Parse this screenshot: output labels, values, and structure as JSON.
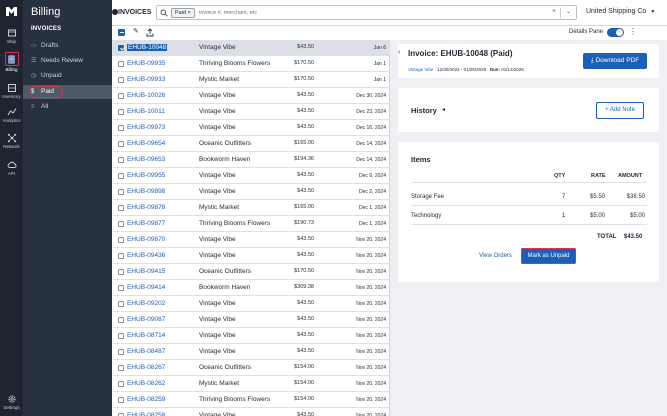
{
  "rail": {
    "items": [
      {
        "label": "Ship",
        "icon": "box-icon"
      },
      {
        "label": "Billing",
        "icon": "receipt-icon"
      },
      {
        "label": "Inventory",
        "icon": "inventory-icon"
      },
      {
        "label": "Analytics",
        "icon": "analytics-icon"
      },
      {
        "label": "Network",
        "icon": "network-icon"
      },
      {
        "label": "API",
        "icon": "cloud-icon"
      }
    ],
    "settings_label": "Settings"
  },
  "nav": {
    "title": "Billing",
    "section": "INVOICES",
    "items": [
      {
        "label": "Drafts",
        "icon": "drafts-icon"
      },
      {
        "label": "Needs Review",
        "icon": "review-icon"
      },
      {
        "label": "Unpaid",
        "icon": "unpaid-icon"
      },
      {
        "label": "Paid",
        "icon": "dollar-icon"
      },
      {
        "label": "All",
        "icon": "all-icon"
      }
    ]
  },
  "topbar": {
    "title": "INVOICES",
    "chip_label": "Paid",
    "chip_close": "×",
    "search_placeholder": "invoice #, merchant, etc",
    "clear": "×",
    "chevron": "⌄",
    "company": "United Shipping Co"
  },
  "toolbar": {
    "details_pane_label": "Details Pane",
    "details_pane_on": true,
    "more": "⋮"
  },
  "invoices": [
    {
      "id": "EHUB-10048",
      "merchant": "Vintage Vibe",
      "amount": "$43.50",
      "date": "Jan 6",
      "selected": true
    },
    {
      "id": "EHUB-09935",
      "merchant": "Thriving Blooms Flowers",
      "amount": "$170.50",
      "date": "Jan 1"
    },
    {
      "id": "EHUB-09933",
      "merchant": "Mystic Market",
      "amount": "$170.50",
      "date": "Jan 1"
    },
    {
      "id": "EHUB-10026",
      "merchant": "Vintage Vibe",
      "amount": "$43.50",
      "date": "Dec 30, 2024"
    },
    {
      "id": "EHUB-10011",
      "merchant": "Vintage Vibe",
      "amount": "$43.50",
      "date": "Dec 23, 2024"
    },
    {
      "id": "EHUB-09973",
      "merchant": "Vintage Vibe",
      "amount": "$43.50",
      "date": "Dec 16, 2024"
    },
    {
      "id": "EHUB-09654",
      "merchant": "Oceanic Outfitters",
      "amount": "$165.00",
      "date": "Dec 14, 2024"
    },
    {
      "id": "EHUB-09653",
      "merchant": "Bookworm Haven",
      "amount": "$194.36",
      "date": "Dec 14, 2024"
    },
    {
      "id": "EHUB-09955",
      "merchant": "Vintage Vibe",
      "amount": "$43.50",
      "date": "Dec 9, 2024"
    },
    {
      "id": "EHUB-09898",
      "merchant": "Vintage Vibe",
      "amount": "$43.50",
      "date": "Dec 2, 2024"
    },
    {
      "id": "EHUB-09878",
      "merchant": "Mystic Market",
      "amount": "$165.00",
      "date": "Dec 1, 2024"
    },
    {
      "id": "EHUB-09877",
      "merchant": "Thriving Blooms Flowers",
      "amount": "$190.73",
      "date": "Dec 1, 2024"
    },
    {
      "id": "EHUB-09670",
      "merchant": "Vintage Vibe",
      "amount": "$43.50",
      "date": "Nov 20, 2024"
    },
    {
      "id": "EHUB-09436",
      "merchant": "Vintage Vibe",
      "amount": "$43.50",
      "date": "Nov 20, 2024"
    },
    {
      "id": "EHUB-09415",
      "merchant": "Oceanic Outfitters",
      "amount": "$170.50",
      "date": "Nov 20, 2024"
    },
    {
      "id": "EHUB-09414",
      "merchant": "Bookworm Haven",
      "amount": "$309.38",
      "date": "Nov 20, 2024"
    },
    {
      "id": "EHUB-09202",
      "merchant": "Vintage Vibe",
      "amount": "$43.50",
      "date": "Nov 20, 2024"
    },
    {
      "id": "EHUB-09087",
      "merchant": "Vintage Vibe",
      "amount": "$43.50",
      "date": "Nov 20, 2024"
    },
    {
      "id": "EHUB-08714",
      "merchant": "Vintage Vibe",
      "amount": "$43.50",
      "date": "Nov 20, 2024"
    },
    {
      "id": "EHUB-08487",
      "merchant": "Vintage Vibe",
      "amount": "$43.50",
      "date": "Nov 20, 2024"
    },
    {
      "id": "EHUB-08267",
      "merchant": "Oceanic Outfitters",
      "amount": "$154.00",
      "date": "Nov 20, 2024"
    },
    {
      "id": "EHUB-08262",
      "merchant": "Mystic Market",
      "amount": "$154.00",
      "date": "Nov 20, 2024"
    },
    {
      "id": "EHUB-08259",
      "merchant": "Thriving Blooms Flowers",
      "amount": "$154.00",
      "date": "Nov 20, 2024"
    },
    {
      "id": "EHUB-08258",
      "merchant": "Vintage Vibe",
      "amount": "$43.50",
      "date": "Nov 20, 2024"
    }
  ],
  "detail": {
    "back": "‹",
    "title": "Invoice: EHUB-10048 (Paid)",
    "merchant_link": "Vintage Vibe",
    "period": "12/30/2024 - 01/05/2025",
    "due_label": "Due:",
    "due_date": "01/12/2025",
    "download_label": "Download PDF",
    "history_label": "History",
    "history_caret": "◂",
    "add_note_label": "+ Add Note",
    "items_title": "Items",
    "columns": {
      "qty": "QTY",
      "rate": "RATE",
      "amount": "AMOUNT"
    },
    "items": [
      {
        "name": "Storage Fee",
        "qty": "7",
        "rate": "$5.50",
        "amount": "$38.50"
      },
      {
        "name": "Technology",
        "qty": "1",
        "rate": "$5.00",
        "amount": "$5.00"
      }
    ],
    "total_label": "TOTAL",
    "total_value": "$43.50",
    "view_orders_label": "View Orders",
    "mark_unpaid_label": "Mark as Unpaid"
  },
  "colors": {
    "accent": "#1c5fb8",
    "rail_bg": "#1e2430",
    "nav_bg": "#283140",
    "highlight_ring": "#d9324a"
  }
}
